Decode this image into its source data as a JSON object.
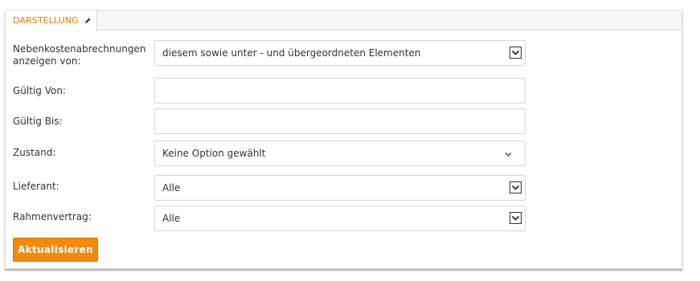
{
  "tab": {
    "label": "DARSTELLUNG",
    "icon": "pencil-icon"
  },
  "form": {
    "nebenkosten": {
      "label": "Nebenkostenabrechnungen anzeigen von:",
      "value": "diesem sowie unter - und übergeordneten Elementen"
    },
    "gueltig_von": {
      "label": "Gültig Von:",
      "value": ""
    },
    "gueltig_bis": {
      "label": "Gültig Bis:",
      "value": ""
    },
    "zustand": {
      "label": "Zustand:",
      "value": "Keine Option gewählt"
    },
    "lieferant": {
      "label": "Lieferant:",
      "value": "Alle"
    },
    "rahmenvertrag": {
      "label": "Rahmenvertrag:",
      "value": "Alle"
    }
  },
  "button": {
    "label": "Aktualisieren"
  },
  "colors": {
    "accent": "#f08a10",
    "tab_text": "#e07b00"
  }
}
